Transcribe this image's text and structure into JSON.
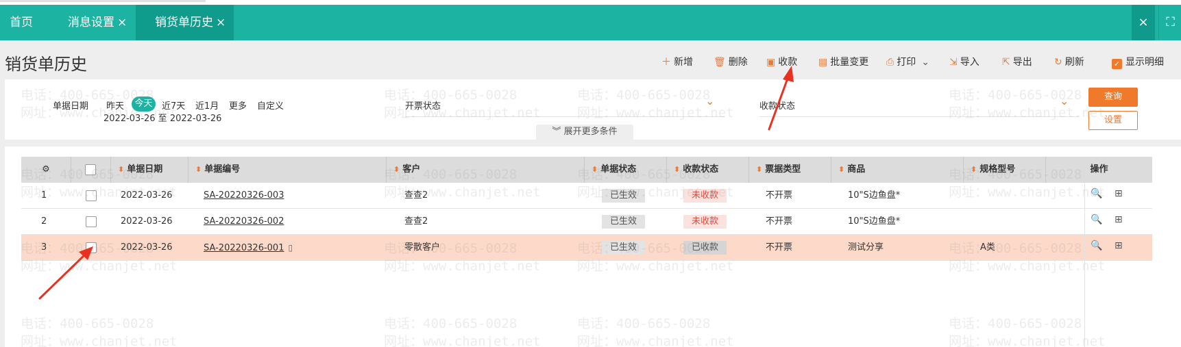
{
  "tabs": [
    {
      "label": "首页"
    },
    {
      "label": "消息设置",
      "close": "×"
    },
    {
      "label": "销货单历史",
      "close": "×"
    }
  ],
  "tab_icons": {
    "close": "×",
    "fullscreen": "⛶"
  },
  "page": {
    "title": "销货单历史"
  },
  "toolbar": {
    "add": "新增",
    "delete": "删除",
    "receive": "收款",
    "batch_change": "批量变更",
    "print": "打印",
    "import": "导入",
    "export": "导出",
    "refresh": "刷新",
    "show_detail": "显示明细"
  },
  "filter": {
    "date_label": "单据日期",
    "options": [
      "昨天",
      "今天",
      "近7天",
      "近1月",
      "更多",
      "自定义"
    ],
    "date_range": "2022-03-26 至 2022-03-26",
    "invoice_label": "开票状态",
    "receipt_label": "收款状态",
    "query": "查询",
    "setting": "设置",
    "expand": "展开更多条件"
  },
  "table": {
    "headers": {
      "date": "单据日期",
      "code": "单据编号",
      "customer": "客户",
      "doc_status": "单据状态",
      "receipt_status": "收款状态",
      "bill_type": "票据类型",
      "product": "商品",
      "spec": "规格型号",
      "ops": "操作"
    },
    "rows": [
      {
        "no": "1",
        "date": "2022-03-26",
        "code": "SA-20220326-003",
        "customer": "查查2",
        "doc_status": "已生效",
        "receipt_status": "未收款",
        "bill_type": "不开票",
        "product": "10\"S边鱼盘*",
        "spec": ""
      },
      {
        "no": "2",
        "date": "2022-03-26",
        "code": "SA-20220326-002",
        "customer": "查查2",
        "doc_status": "已生效",
        "receipt_status": "未收款",
        "bill_type": "不开票",
        "product": "10\"S边鱼盘*",
        "spec": ""
      },
      {
        "no": "3",
        "date": "2022-03-26",
        "code": "SA-20220326-001",
        "customer": "零散客户",
        "doc_status": "已生效",
        "receipt_status": "已收款",
        "bill_type": "不开票",
        "product": "测试分享",
        "spec": "A类"
      }
    ]
  },
  "watermark": {
    "phone": "电话：400-665-0028",
    "site": "网址：www.chanjet.net"
  },
  "colors": {
    "teal": "#1db3a3",
    "orange": "#f07a2b",
    "highlight_row": "#fcd9c8",
    "arrow": "#e8321f"
  }
}
